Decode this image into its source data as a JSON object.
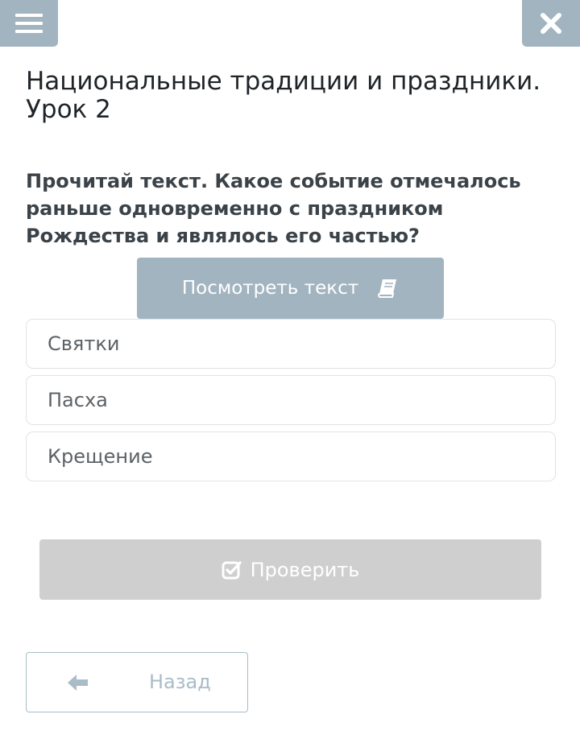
{
  "header": {
    "menu_icon": "hamburger-icon",
    "close_icon": "close-icon"
  },
  "lesson": {
    "title": "Национальные традиции и праздники. Урок 2"
  },
  "question": {
    "text": "Прочитай текст. Какое событие отмечалось раньше одновременно с праздником Рождества и являлось его частью?"
  },
  "view_text_button": {
    "label": "Посмотреть текст",
    "icon": "book-icon"
  },
  "answers": [
    {
      "label": "Святки"
    },
    {
      "label": "Пасха"
    },
    {
      "label": "Крещение"
    }
  ],
  "check_button": {
    "label": "Проверить",
    "icon": "checkbox-icon"
  },
  "back_button": {
    "label": "Назад",
    "icon": "arrow-left-icon"
  },
  "colors": {
    "accent": "#a2b4c0",
    "disabled": "#cfcfcf",
    "border": "#dfe3e6"
  }
}
